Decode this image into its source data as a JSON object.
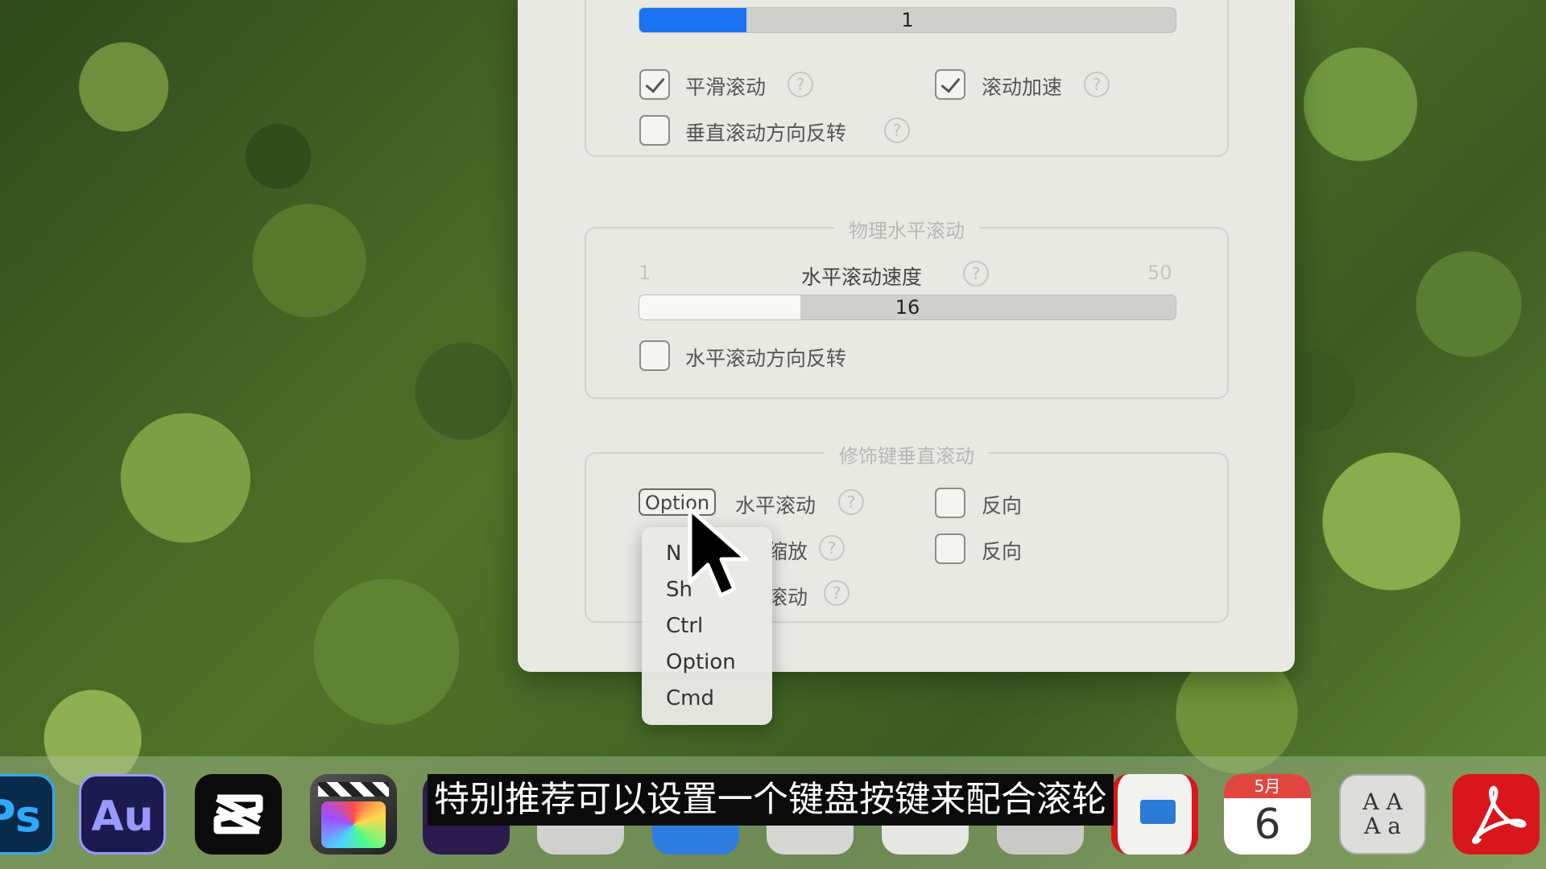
{
  "scroll_section": {
    "speed_value": "1",
    "smooth_scroll_label": "平滑滚动",
    "smooth_scroll_checked": true,
    "scroll_accel_label": "滚动加速",
    "scroll_accel_checked": true,
    "vertical_reverse_label": "垂直滚动方向反转",
    "vertical_reverse_checked": false
  },
  "horizontal_section": {
    "title": "物理水平滚动",
    "speed_label": "水平滚动速度",
    "min": "1",
    "max": "50",
    "value": "16",
    "fill_fraction": 0.3,
    "reverse_label": "水平滚动方向反转",
    "reverse_checked": false
  },
  "modifier_section": {
    "title": "修饰键垂直滚动",
    "popup_value": "Option",
    "row1_label": "水平滚动",
    "row1_reverse": "反向",
    "row2_label_partial": "缩放",
    "row2_reverse": "反向",
    "row3_label_partial": "滚动"
  },
  "help_glyph": "?",
  "dropdown": {
    "items": [
      "None",
      "Shift",
      "Ctrl",
      "Option",
      "Cmd"
    ],
    "visible_items": [
      "N",
      "Sh",
      "Ctrl",
      "Option",
      "Cmd"
    ]
  },
  "dock": {
    "apps": [
      {
        "name": "photoshop-icon",
        "text": "Ps",
        "bg": "#0a2a4a",
        "fg": "#31a8ff"
      },
      {
        "name": "audition-icon",
        "text": "Au",
        "bg": "#1d1a4f",
        "fg": "#9999ff"
      },
      {
        "name": "capcut-icon",
        "text": "",
        "bg": "#0b0b0b",
        "fg": "#ffffff"
      },
      {
        "name": "final-cut-icon",
        "text": "",
        "bg": "#3a3a3a",
        "fg": "#ffffff"
      },
      {
        "name": "calendar-icon",
        "month": "5月",
        "day": "6"
      },
      {
        "name": "font-book-icon",
        "text": "A A\nA a",
        "bg": "#d9d9d9",
        "fg": "#444"
      },
      {
        "name": "acrobat-icon",
        "text": "",
        "bg": "#d8161b",
        "fg": "#ffffff"
      }
    ]
  },
  "subtitle": "特别推荐可以设置一个键盘按键来配合滚轮",
  "colors": {
    "accent_blue": "#1a73f0",
    "slider_white": "#f7f7f5",
    "window_bg": "#e9e9e4"
  }
}
